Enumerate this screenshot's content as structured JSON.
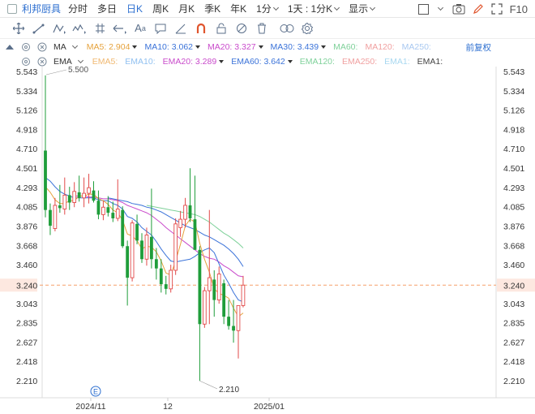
{
  "topbar": {
    "title": "利邦厨具",
    "periods": [
      {
        "label": "分时",
        "active": false
      },
      {
        "label": "多日",
        "active": false
      },
      {
        "label": "日K",
        "active": true
      },
      {
        "label": "周K",
        "active": false
      },
      {
        "label": "月K",
        "active": false
      },
      {
        "label": "季K",
        "active": false
      },
      {
        "label": "年K",
        "active": false
      }
    ],
    "minute_select": "1分",
    "range_select": "1天 : 1分K",
    "display_select": "显示",
    "zoom_label": "F10"
  },
  "toolbar": {
    "tools": [
      "crosshair-icon",
      "line-icon",
      "pattern-icon",
      "wave-icon",
      "flag-icon",
      "hash-icon",
      "arrow-icon",
      "text-icon",
      "comment-icon",
      "ruler-icon",
      "magnet-icon",
      "lock-icon",
      "visibility-icon",
      "delete-icon",
      "compare-icon",
      "settings-icon"
    ]
  },
  "ma_row": {
    "name": "MA",
    "lines": [
      {
        "label": "MA5: 2.904",
        "color": "#e6a23c",
        "arrow": true
      },
      {
        "label": "MA10: 3.062",
        "color": "#3b73d9",
        "arrow": true
      },
      {
        "label": "MA20: 3.327",
        "color": "#c94bcb",
        "arrow": true
      },
      {
        "label": "MA30: 3.439",
        "color": "#3b73d9",
        "arrow": true
      },
      {
        "label": "MA60:",
        "color": "#7fd19a",
        "arrow": false
      },
      {
        "label": "MA120:",
        "color": "#f0a0a0",
        "arrow": false
      },
      {
        "label": "MA250:",
        "color": "#a8c8f0",
        "arrow": false
      }
    ],
    "fq_label": "前复权"
  },
  "ema_row": {
    "name": "EMA",
    "lines": [
      {
        "label": "EMA5:",
        "color": "#f0b870",
        "arrow": false
      },
      {
        "label": "EMA10:",
        "color": "#90c0f0",
        "arrow": false
      },
      {
        "label": "EMA20: 3.289",
        "color": "#c94bcb",
        "arrow": true
      },
      {
        "label": "EMA60: 3.642",
        "color": "#3b73d9",
        "arrow": true
      },
      {
        "label": "EMA120:",
        "color": "#7fd19a",
        "arrow": false
      },
      {
        "label": "EMA250:",
        "color": "#f0a0a0",
        "arrow": false
      },
      {
        "label": "EMA1:",
        "color": "#a8d8f0",
        "arrow": false
      },
      {
        "label": "EMA1:",
        "color": "#444444",
        "arrow": false
      }
    ]
  },
  "chart_data": {
    "type": "candlestick",
    "y_ticks": [
      "5.543",
      "5.334",
      "5.126",
      "4.918",
      "4.710",
      "4.501",
      "4.293",
      "4.085",
      "3.876",
      "3.668",
      "3.460",
      "3.240",
      "3.043",
      "2.835",
      "2.627",
      "2.418",
      "2.210"
    ],
    "ylim": [
      2.21,
      5.543
    ],
    "current_price": "3.240",
    "high_label": "5.500",
    "low_label": "2.210",
    "x_ticks": [
      "2024/11",
      "12",
      "2025/01"
    ],
    "event_marker": "E",
    "colors": {
      "up": "#e24a4a",
      "down": "#1f9d3a",
      "ma5": "#e6a23c",
      "ma10": "#3b73d9",
      "ma20": "#c94bcb",
      "ma30": "#3b73d9",
      "ma60": "#7fd19a",
      "price_line": "#f5a06a"
    },
    "candles": [
      {
        "o": 4.69,
        "h": 5.5,
        "l": 3.97,
        "c": 4.05
      },
      {
        "o": 4.05,
        "h": 4.12,
        "l": 3.78,
        "c": 3.88
      },
      {
        "o": 3.85,
        "h": 4.18,
        "l": 3.82,
        "c": 4.1
      },
      {
        "o": 4.1,
        "h": 4.32,
        "l": 4.02,
        "c": 4.07
      },
      {
        "o": 4.06,
        "h": 4.4,
        "l": 4.0,
        "c": 4.21
      },
      {
        "o": 4.21,
        "h": 4.3,
        "l": 4.05,
        "c": 4.13
      },
      {
        "o": 4.13,
        "h": 4.35,
        "l": 4.08,
        "c": 4.25
      },
      {
        "o": 4.24,
        "h": 4.42,
        "l": 4.14,
        "c": 4.18
      },
      {
        "o": 4.18,
        "h": 4.4,
        "l": 4.08,
        "c": 4.23
      },
      {
        "o": 4.23,
        "h": 4.44,
        "l": 4.12,
        "c": 4.29
      },
      {
        "o": 4.26,
        "h": 4.36,
        "l": 4.13,
        "c": 4.15
      },
      {
        "o": 4.15,
        "h": 4.26,
        "l": 3.95,
        "c": 4.0
      },
      {
        "o": 4.0,
        "h": 4.15,
        "l": 3.94,
        "c": 4.08
      },
      {
        "o": 4.08,
        "h": 4.2,
        "l": 3.98,
        "c": 4.02
      },
      {
        "o": 4.02,
        "h": 4.14,
        "l": 3.92,
        "c": 3.96
      },
      {
        "o": 3.96,
        "h": 4.38,
        "l": 3.93,
        "c": 4.06
      },
      {
        "o": 4.05,
        "h": 4.09,
        "l": 3.64,
        "c": 3.66
      },
      {
        "o": 3.66,
        "h": 3.72,
        "l": 3.02,
        "c": 3.32
      },
      {
        "o": 3.32,
        "h": 3.94,
        "l": 3.28,
        "c": 3.91
      },
      {
        "o": 3.9,
        "h": 4.0,
        "l": 3.68,
        "c": 3.72
      },
      {
        "o": 3.72,
        "h": 3.8,
        "l": 3.48,
        "c": 3.52
      },
      {
        "o": 3.52,
        "h": 3.86,
        "l": 3.45,
        "c": 3.78
      },
      {
        "o": 3.76,
        "h": 4.28,
        "l": 3.42,
        "c": 3.52
      },
      {
        "o": 3.52,
        "h": 3.64,
        "l": 3.3,
        "c": 3.42
      },
      {
        "o": 3.42,
        "h": 3.52,
        "l": 3.16,
        "c": 3.25
      },
      {
        "o": 3.25,
        "h": 3.34,
        "l": 3.14,
        "c": 3.2
      },
      {
        "o": 3.2,
        "h": 3.46,
        "l": 3.16,
        "c": 3.4
      },
      {
        "o": 3.4,
        "h": 3.96,
        "l": 3.35,
        "c": 3.9
      },
      {
        "o": 3.86,
        "h": 4.04,
        "l": 3.76,
        "c": 3.95
      },
      {
        "o": 3.95,
        "h": 4.18,
        "l": 3.86,
        "c": 4.1
      },
      {
        "o": 4.1,
        "h": 4.5,
        "l": 3.92,
        "c": 3.96
      },
      {
        "o": 3.95,
        "h": 4.42,
        "l": 3.7,
        "c": 3.62
      },
      {
        "o": 3.62,
        "h": 3.66,
        "l": 2.21,
        "c": 2.82
      },
      {
        "o": 2.82,
        "h": 3.22,
        "l": 2.78,
        "c": 3.18
      },
      {
        "o": 3.18,
        "h": 4.05,
        "l": 2.82,
        "c": 3.32
      },
      {
        "o": 3.3,
        "h": 3.4,
        "l": 2.9,
        "c": 3.08
      },
      {
        "o": 3.08,
        "h": 3.44,
        "l": 3.04,
        "c": 3.36
      },
      {
        "o": 3.26,
        "h": 3.3,
        "l": 2.82,
        "c": 2.9
      },
      {
        "o": 2.9,
        "h": 3.08,
        "l": 2.76,
        "c": 2.8
      },
      {
        "o": 2.8,
        "h": 3.08,
        "l": 2.62,
        "c": 2.75
      },
      {
        "o": 2.75,
        "h": 2.98,
        "l": 2.45,
        "c": 3.02
      },
      {
        "o": 3.02,
        "h": 3.34,
        "l": 3.0,
        "c": 3.24
      }
    ],
    "ma5": [
      4.3,
      4.24,
      4.16,
      4.12,
      4.12,
      4.15,
      4.15,
      4.2,
      4.2,
      4.22,
      4.22,
      4.17,
      4.15,
      4.11,
      4.05,
      4.02,
      3.94,
      3.79,
      3.77,
      3.72,
      3.63,
      3.66,
      3.65,
      3.6,
      3.5,
      3.37,
      3.35,
      3.5,
      3.68,
      3.88,
      3.95,
      3.92,
      3.69,
      3.52,
      3.38,
      3.2,
      3.15,
      3.13,
      3.1,
      2.99,
      2.9,
      2.94
    ],
    "ma10": [
      4.4,
      4.36,
      4.3,
      4.25,
      4.22,
      4.2,
      4.18,
      4.18,
      4.18,
      4.18,
      4.18,
      4.16,
      4.15,
      4.15,
      4.12,
      4.1,
      4.06,
      3.98,
      3.96,
      3.92,
      3.86,
      3.82,
      3.78,
      3.71,
      3.63,
      3.56,
      3.5,
      3.49,
      3.5,
      3.51,
      3.52,
      3.55,
      3.59,
      3.62,
      3.64,
      3.59,
      3.47,
      3.35,
      3.26,
      3.16,
      3.08,
      3.06
    ],
    "ma20": [
      null,
      null,
      null,
      null,
      null,
      null,
      4.2,
      4.2,
      4.2,
      4.19,
      4.19,
      4.18,
      4.17,
      4.17,
      4.16,
      4.15,
      4.13,
      4.1,
      4.08,
      4.06,
      4.04,
      4.02,
      3.99,
      3.95,
      3.91,
      3.86,
      3.82,
      3.78,
      3.74,
      3.7,
      3.66,
      3.62,
      3.58,
      3.55,
      3.53,
      3.52,
      3.49,
      3.45,
      3.42,
      3.38,
      3.34,
      3.33
    ],
    "ma30": [
      null,
      null,
      null,
      null,
      null,
      null,
      null,
      null,
      null,
      null,
      null,
      null,
      null,
      4.18,
      4.17,
      4.16,
      4.15,
      4.14,
      4.12,
      4.11,
      4.1,
      4.08,
      4.07,
      4.05,
      4.03,
      4.0,
      3.97,
      3.94,
      3.91,
      3.88,
      3.86,
      3.84,
      3.81,
      3.78,
      3.76,
      3.73,
      3.7,
      3.67,
      3.63,
      3.58,
      3.52,
      3.44
    ],
    "ma60": [
      null,
      null,
      null,
      null,
      null,
      null,
      null,
      null,
      null,
      null,
      null,
      null,
      null,
      null,
      null,
      null,
      null,
      null,
      null,
      null,
      null,
      4.1,
      4.09,
      4.08,
      4.07,
      4.06,
      4.05,
      4.04,
      4.03,
      4.02,
      4.01,
      4.0,
      3.98,
      3.95,
      3.92,
      3.88,
      3.84,
      3.8,
      3.77,
      3.73,
      3.69,
      3.64
    ]
  }
}
